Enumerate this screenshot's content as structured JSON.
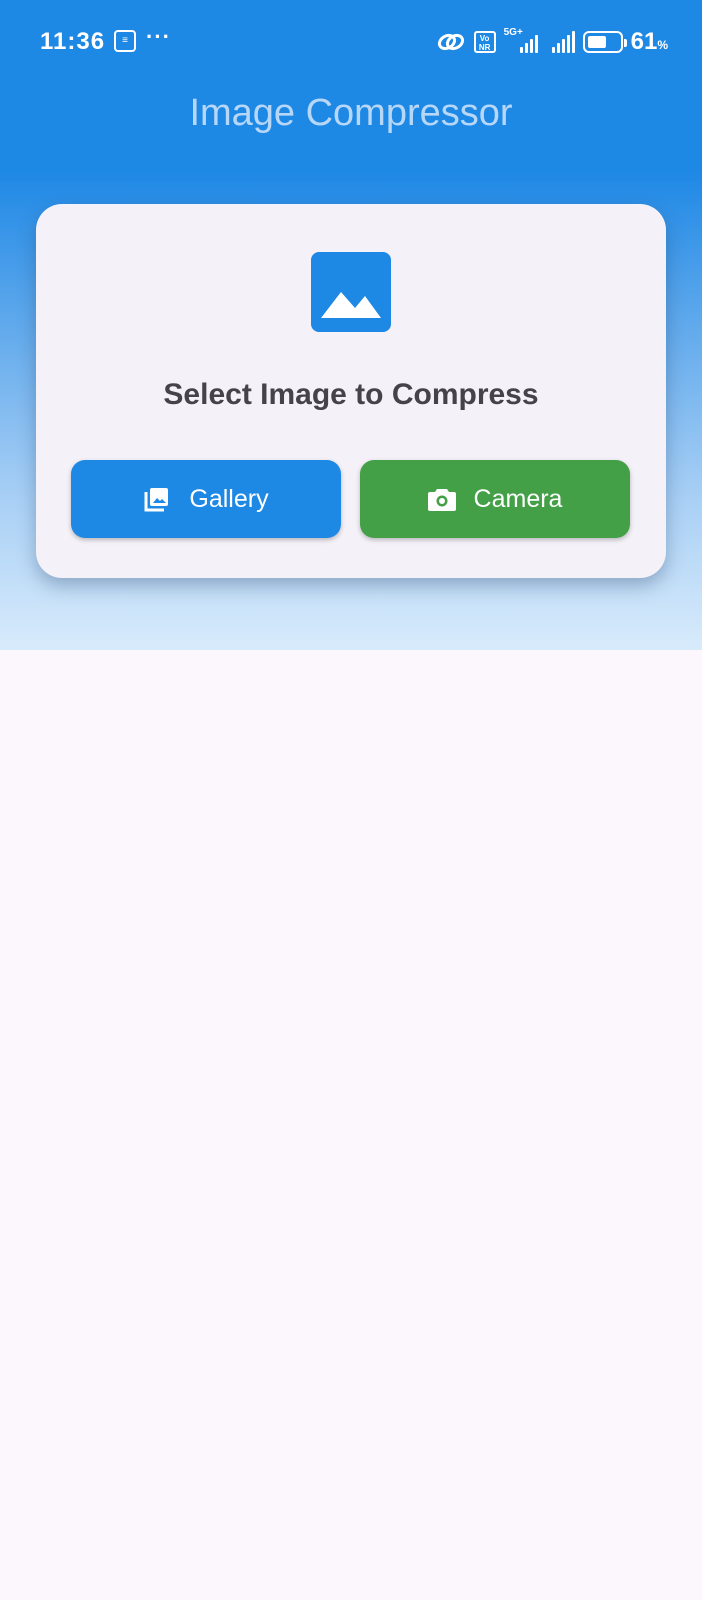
{
  "status_bar": {
    "time": "11:36",
    "sim_icon_label": "≡",
    "overflow": "···",
    "volte": "Vo NR",
    "network": "5G+",
    "battery_level": 61,
    "battery_text": "61",
    "battery_unit": "%"
  },
  "app": {
    "title": "Image Compressor"
  },
  "card": {
    "icon": "image-icon",
    "heading": "Select Image to Compress",
    "gallery_label": "Gallery",
    "gallery_icon": "photo-library-icon",
    "camera_label": "Camera",
    "camera_icon": "camera-icon"
  },
  "colors": {
    "primary": "#1e88e5",
    "camera_button": "#43a047",
    "card_background": "#f4f2f8",
    "page_background": "#fcf6fd",
    "title_text": "#b6d7f7"
  }
}
